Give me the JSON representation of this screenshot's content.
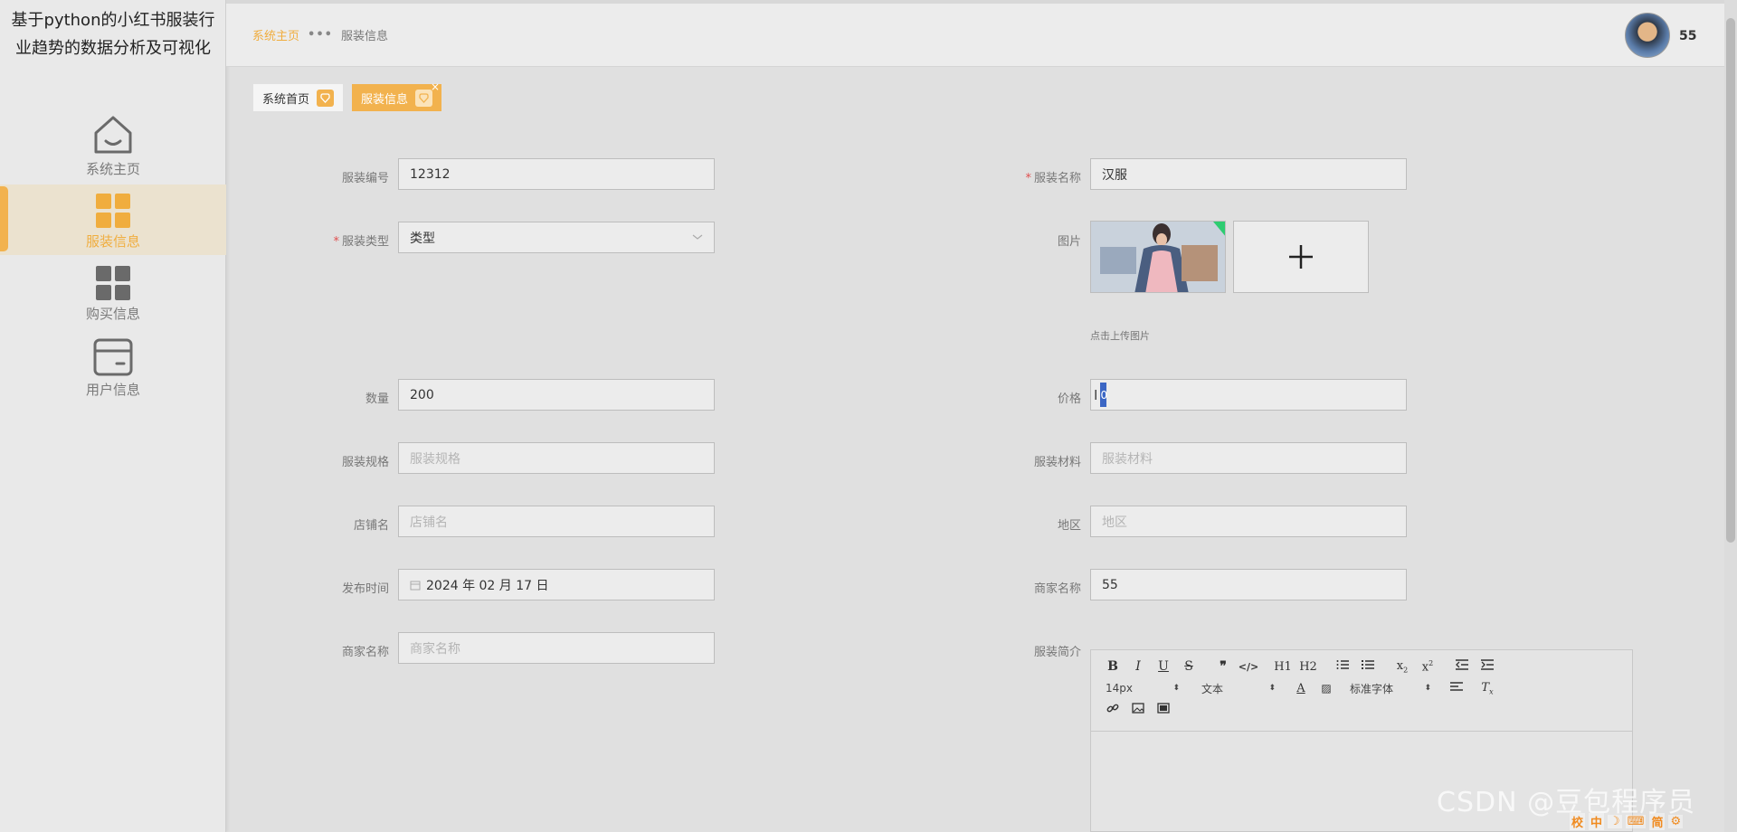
{
  "sidebar": {
    "title": "基于python的小红书服装行业趋势的数据分析及可视化",
    "items": [
      {
        "label": "系统主页",
        "icon": "home-icon"
      },
      {
        "label": "服装信息",
        "icon": "grid-icon"
      },
      {
        "label": "购买信息",
        "icon": "grid-icon"
      },
      {
        "label": "用户信息",
        "icon": "card-icon"
      }
    ]
  },
  "header": {
    "breadcrumb": {
      "home": "系统主页",
      "current": "服装信息"
    },
    "username": "55"
  },
  "tabs": [
    {
      "label": "系统首页"
    },
    {
      "label": "服装信息",
      "close": "×"
    }
  ],
  "form": {
    "code": {
      "label": "服装编号",
      "value": "12312"
    },
    "name": {
      "label": "服装名称",
      "value": "汉服"
    },
    "type": {
      "label": "服装类型",
      "value": "类型"
    },
    "image": {
      "label": "图片",
      "hint": "点击上传图片"
    },
    "quantity": {
      "label": "数量",
      "value": "200"
    },
    "price": {
      "label": "价格",
      "value": "0"
    },
    "spec": {
      "label": "服装规格",
      "placeholder": "服装规格"
    },
    "material": {
      "label": "服装材料",
      "placeholder": "服装材料"
    },
    "shop": {
      "label": "店铺名",
      "placeholder": "店铺名"
    },
    "region": {
      "label": "地区",
      "placeholder": "地区"
    },
    "publish_time": {
      "label": "发布时间",
      "value": "2024 年 02 月 17 日"
    },
    "merchant": {
      "label": "商家名称",
      "value": "55"
    },
    "merchant2": {
      "label": "商家名称",
      "placeholder": "商家名称"
    },
    "intro": {
      "label": "服装简介"
    }
  },
  "editor": {
    "font_size": "14px",
    "block": "文本",
    "font_family": "标准字体",
    "h1": "H1",
    "h2": "H2"
  },
  "watermark": "CSDN @豆包程序员",
  "ime": [
    "校",
    "中",
    "简"
  ],
  "colors": {
    "accent": "#f2b24e",
    "required": "#e05050",
    "selection": "#3b66c4"
  }
}
